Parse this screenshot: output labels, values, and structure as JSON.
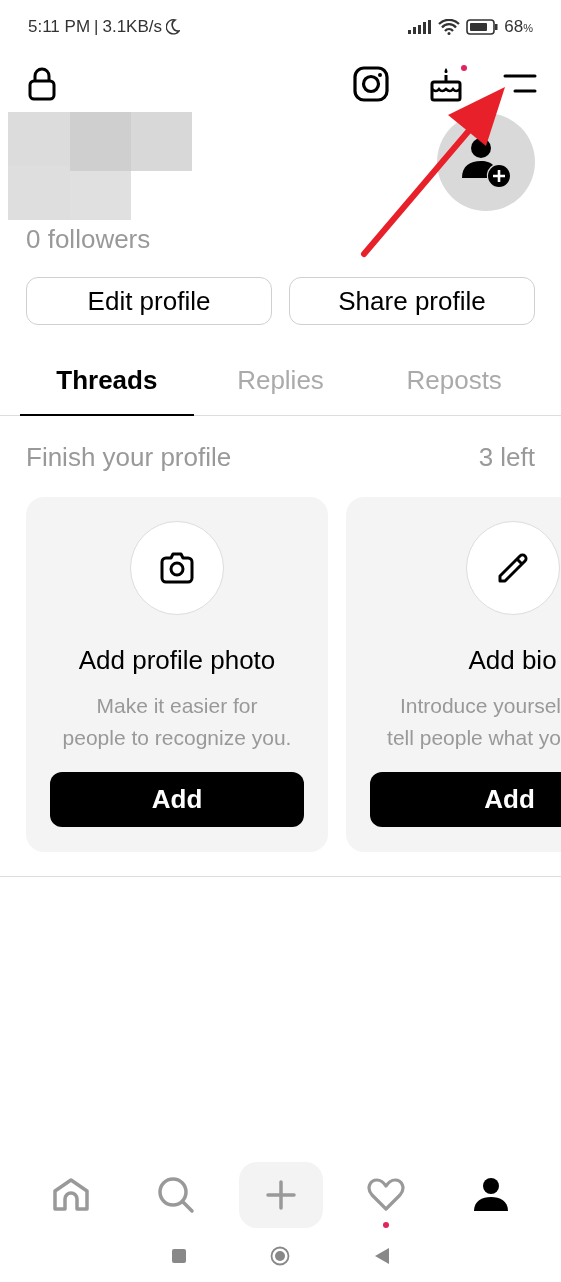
{
  "status_bar": {
    "time": "5:11 PM",
    "separator": "|",
    "speed": "3.1KB/s",
    "battery": "68",
    "battery_unit": "%"
  },
  "header": {
    "birthday_badge": true
  },
  "profile": {
    "followers": "0 followers"
  },
  "actions": [
    "Edit profile",
    "Share profile"
  ],
  "tabs": [
    {
      "label": "Threads",
      "selected": true
    },
    {
      "label": "Replies",
      "selected": false
    },
    {
      "label": "Reposts",
      "selected": false
    }
  ],
  "finish_profile": {
    "title": "Finish your profile",
    "remaining": "3 left"
  },
  "cards": [
    {
      "title": "Add profile photo",
      "lines": [
        "Make it easier for",
        "people to recognize you."
      ],
      "button": "Add"
    },
    {
      "title": "Add bio",
      "lines": [
        "Introduce yoursel",
        "tell people what yo"
      ],
      "button": "Add"
    }
  ],
  "bottom_nav": [
    {
      "selected": false,
      "badge": false
    },
    {
      "selected": false,
      "badge": false
    },
    {
      "selected": false,
      "badge": false
    },
    {
      "selected": false,
      "badge": true
    },
    {
      "selected": true,
      "badge": false
    }
  ]
}
